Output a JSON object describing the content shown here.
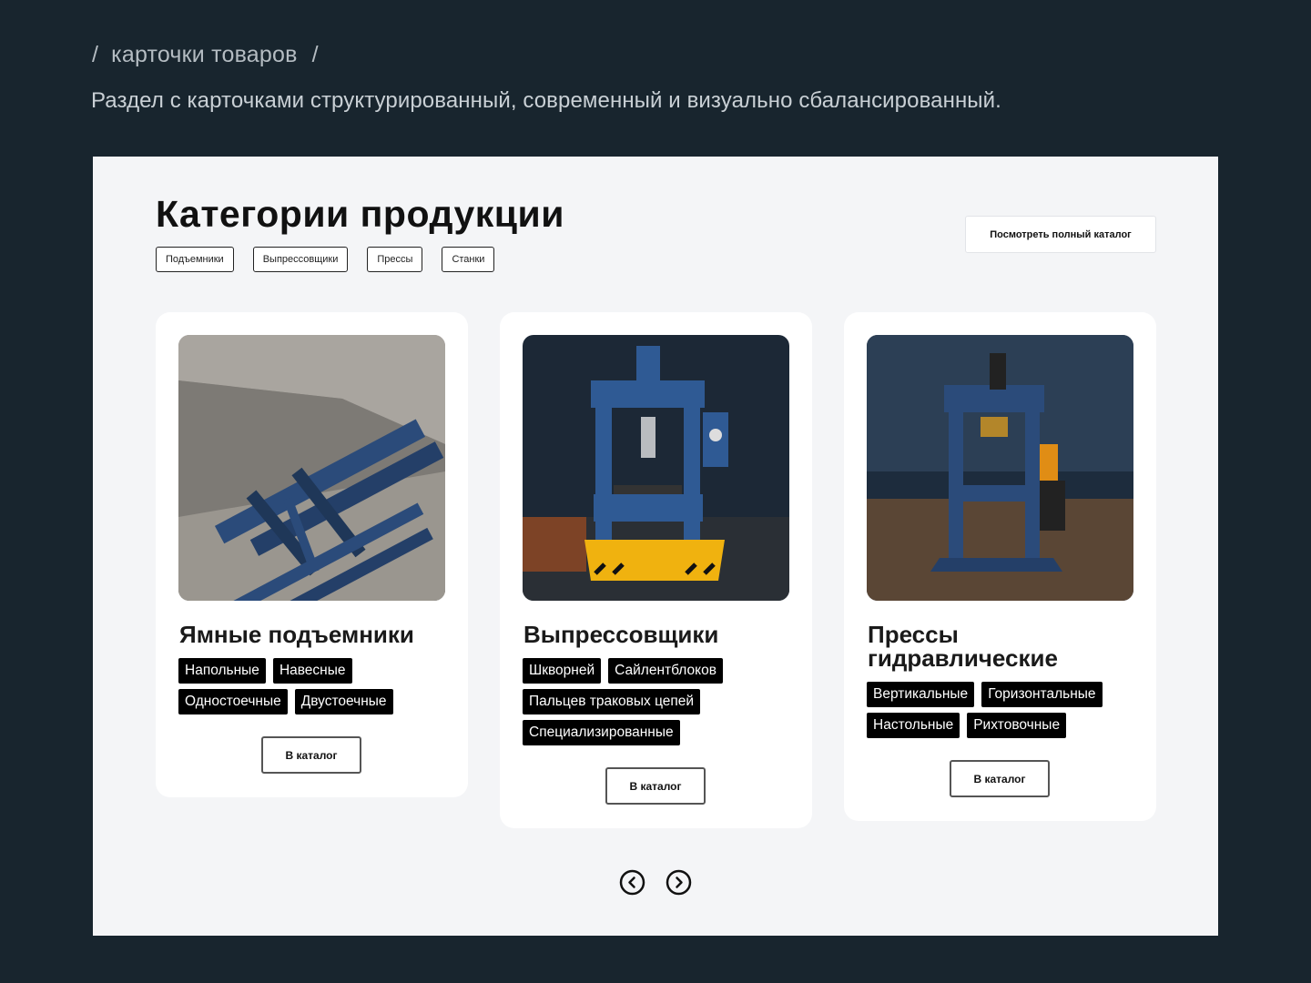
{
  "header": {
    "breadcrumb_prefix": "/",
    "breadcrumb_text": "карточки товаров",
    "breadcrumb_suffix": "/",
    "subtitle": "Раздел с карточками структурированный, современный и визуально сбалансированный."
  },
  "section": {
    "title": "Категории продукции",
    "filters": [
      "Подъемники",
      "Выпрессовщики",
      "Прессы",
      "Станки"
    ],
    "catalog_button": "Посмотреть полный каталог"
  },
  "cards": [
    {
      "title": "Ямные подъемники",
      "image_icon": "scissor-lift-image",
      "tags": [
        "Напольные",
        "Навесные",
        "Одностоечные",
        "Двустоечные"
      ],
      "button": "В каталог"
    },
    {
      "title": "Выпрессовщики",
      "image_icon": "press-machine-image",
      "tags": [
        "Шкворней",
        "Сайлентблоков",
        "Пальцев траковых цепей",
        "Специализированные"
      ],
      "button": "В каталог"
    },
    {
      "title": "Прессы гидравлические",
      "image_icon": "hydraulic-press-image",
      "tags": [
        "Вертикальные",
        "Горизонтальные",
        "Настольные",
        "Рихтовочные"
      ],
      "button": "В каталог"
    }
  ],
  "pager": {
    "prev_icon": "chevron-left-icon",
    "next_icon": "chevron-right-icon"
  },
  "colors": {
    "page_bg": "#18252e",
    "panel_bg": "#f4f5f7",
    "tag_bg": "#000000",
    "machine_blue": "#2b4b7a"
  }
}
